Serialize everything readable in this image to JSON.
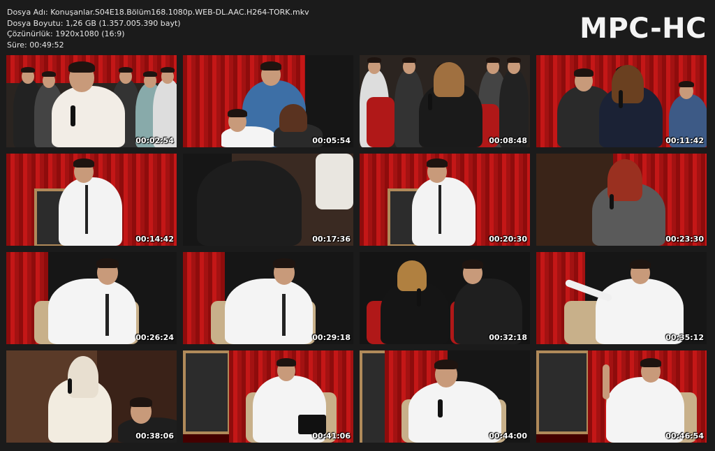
{
  "info": {
    "file_name": "Dosya Adı: Konuşanlar.S04E18.Bölüm168.1080p.WEB-DL.AAC.H264-TORK.mkv",
    "file_size": "Dosya Boyutu: 1,26 GB (1.357.005.390 bayt)",
    "resolution": "Çözünürlük: 1920x1080 (16:9)",
    "duration": "Süre: 00:49:52"
  },
  "logo": "MPC-HC",
  "thumbnails": [
    {
      "time": "00:02:54",
      "scene": "audience-man"
    },
    {
      "time": "00:05:54",
      "scene": "audience-blue"
    },
    {
      "time": "00:08:48",
      "scene": "audience-woman-mic"
    },
    {
      "time": "00:11:42",
      "scene": "audience-women"
    },
    {
      "time": "00:14:42",
      "scene": "host-standing"
    },
    {
      "time": "00:17:36",
      "scene": "back-shirt"
    },
    {
      "time": "00:20:30",
      "scene": "host-standing"
    },
    {
      "time": "00:23:30",
      "scene": "woman-redhair"
    },
    {
      "time": "00:26:24",
      "scene": "host-seated"
    },
    {
      "time": "00:29:18",
      "scene": "host-seated"
    },
    {
      "time": "00:32:18",
      "scene": "audience-pair"
    },
    {
      "time": "00:35:12",
      "scene": "host-pointing"
    },
    {
      "time": "00:38:06",
      "scene": "audience-hijab"
    },
    {
      "time": "00:41:06",
      "scene": "host-seated-wide"
    },
    {
      "time": "00:44:00",
      "scene": "host-closeup"
    },
    {
      "time": "00:46:54",
      "scene": "host-wave"
    }
  ]
}
